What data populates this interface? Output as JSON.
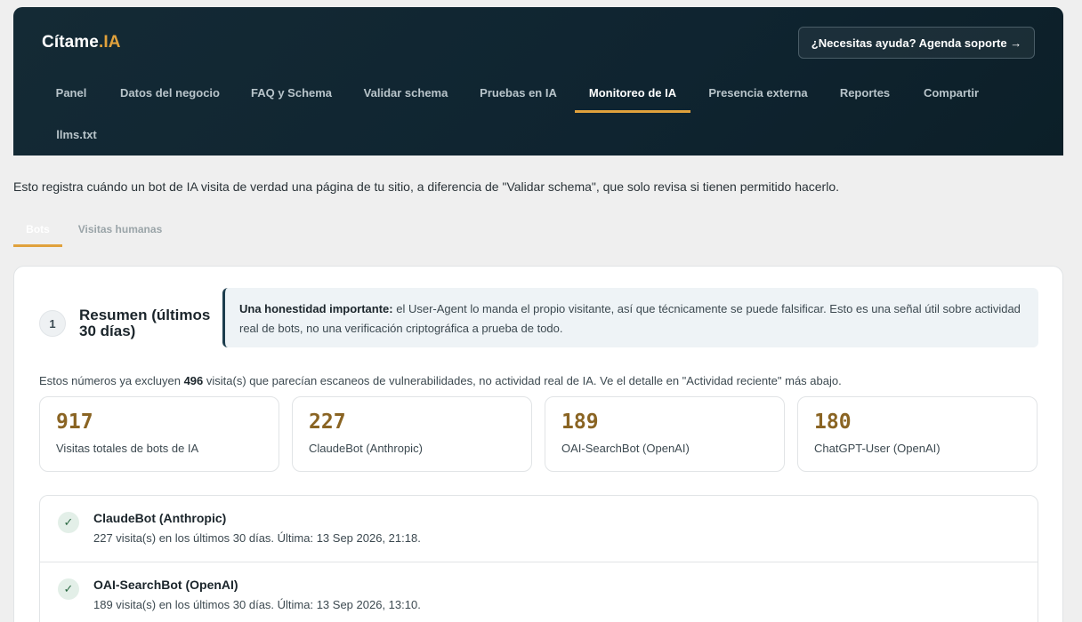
{
  "brand": {
    "name": "Cítame",
    "accent": ".IA"
  },
  "help_button": "¿Necesitas ayuda? Agenda soporte →",
  "nav": [
    {
      "label": "Panel"
    },
    {
      "label": "Datos del negocio"
    },
    {
      "label": "FAQ y Schema"
    },
    {
      "label": "Validar schema"
    },
    {
      "label": "Pruebas en IA"
    },
    {
      "label": "Monitoreo de IA",
      "active": true
    },
    {
      "label": "Presencia externa"
    },
    {
      "label": "Reportes"
    },
    {
      "label": "Compartir"
    },
    {
      "label": "llms.txt"
    }
  ],
  "intro": "Esto registra cuándo un bot de IA visita de verdad una página de tu sitio, a diferencia de \"Validar schema\", que solo revisa si tienen permitido hacerlo.",
  "tabs": [
    {
      "label": "Bots",
      "active": true
    },
    {
      "label": "Visitas humanas"
    }
  ],
  "section": {
    "step": "1",
    "title": "Resumen (últimos 30 días)",
    "notice_bold": "Una honestidad importante:",
    "notice_text": " el User-Agent lo manda el propio visitante, así que técnicamente se puede falsificar. Esto es una señal útil sobre actividad real de bots, no una verificación criptográfica a prueba de todo.",
    "note_pre": "Estos números ya excluyen ",
    "note_count": "496",
    "note_post": " visita(s) que parecían escaneos de vulnerabilidades, no actividad real de IA. Ve el detalle en \"Actividad reciente\" más abajo."
  },
  "stats": [
    {
      "value": "917",
      "label": "Visitas totales de bots de IA"
    },
    {
      "value": "227",
      "label": "ClaudeBot (Anthropic)"
    },
    {
      "value": "189",
      "label": "OAI-SearchBot (OpenAI)"
    },
    {
      "value": "180",
      "label": "ChatGPT-User (OpenAI)"
    }
  ],
  "bots": [
    {
      "name": "ClaudeBot (Anthropic)",
      "detail": "227 visita(s) en los últimos 30 días. Última: 13 Sep 2026, 21:18."
    },
    {
      "name": "OAI-SearchBot (OpenAI)",
      "detail": "189 visita(s) en los últimos 30 días. Última: 13 Sep 2026, 13:10."
    }
  ],
  "colors": {
    "accent": "#e0a13c",
    "header_bg": "#0f2430",
    "stat_number": "#8a6423"
  },
  "icons": {
    "check": "check-icon"
  }
}
